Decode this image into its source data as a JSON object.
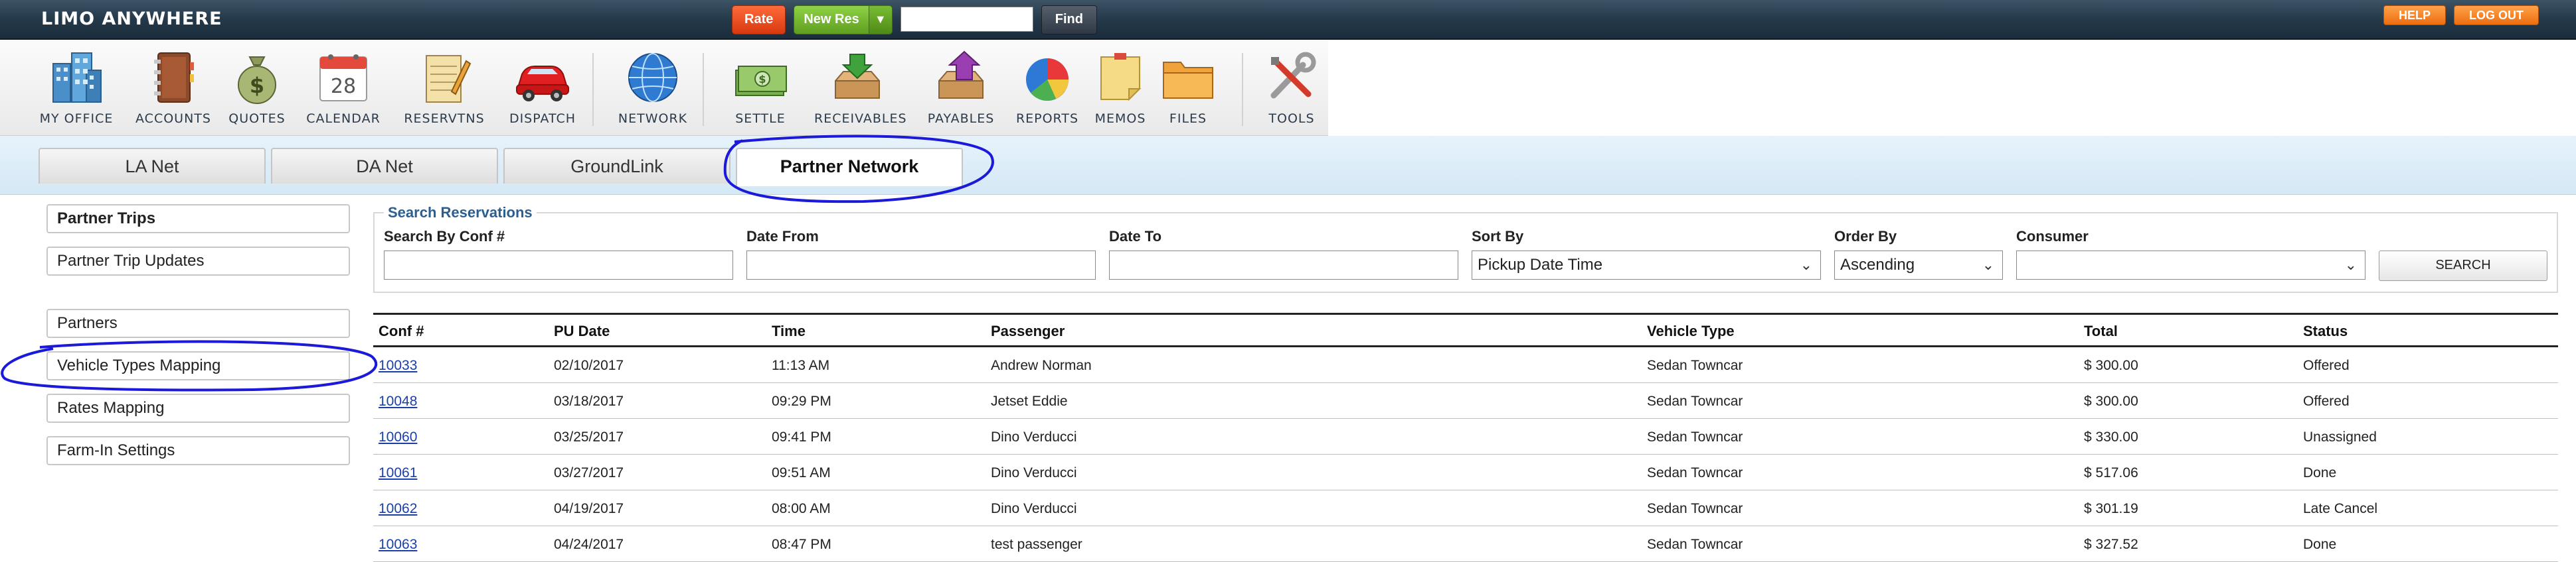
{
  "app": {
    "logo": "LIMO ANYWHERE"
  },
  "topbar": {
    "rate_label": "Rate",
    "new_res_label": "New Res",
    "search_value": "",
    "find_label": "Find",
    "help_label": "HELP",
    "logout_label": "LOG OUT"
  },
  "toolbar": {
    "items": [
      {
        "label": "MY OFFICE",
        "icon": "office-building-icon"
      },
      {
        "label": "ACCOUNTS",
        "icon": "address-book-icon"
      },
      {
        "label": "QUOTES",
        "icon": "money-bag-icon"
      },
      {
        "label": "CALENDAR",
        "icon": "calendar-icon",
        "day": "28"
      },
      {
        "label": "RESERVTNS",
        "icon": "notepad-icon"
      },
      {
        "label": "DISPATCH",
        "icon": "red-car-icon"
      },
      {
        "label": "NETWORK",
        "icon": "globe-icon"
      },
      {
        "label": "SETTLE",
        "icon": "cash-icon"
      },
      {
        "label": "RECEIVABLES",
        "icon": "inbox-arrow-icon"
      },
      {
        "label": "PAYABLES",
        "icon": "outbox-arrow-icon"
      },
      {
        "label": "REPORTS",
        "icon": "pie-chart-icon"
      },
      {
        "label": "MEMOS",
        "icon": "sticky-note-icon"
      },
      {
        "label": "FILES",
        "icon": "folder-icon"
      },
      {
        "label": "TOOLS",
        "icon": "tools-icon"
      }
    ]
  },
  "tabs": [
    {
      "label": "LA Net"
    },
    {
      "label": "DA Net"
    },
    {
      "label": "GroundLink"
    },
    {
      "label": "Partner Network"
    }
  ],
  "sidebar": {
    "items": [
      {
        "label": "Partner Trips"
      },
      {
        "label": "Partner Trip Updates"
      },
      {
        "label": "Partners"
      },
      {
        "label": "Vehicle Types Mapping"
      },
      {
        "label": "Rates Mapping"
      },
      {
        "label": "Farm-In Settings"
      }
    ]
  },
  "search": {
    "legend": "Search Reservations",
    "conf_label": "Search By Conf #",
    "conf_value": "",
    "date_from_label": "Date From",
    "date_from_value": "",
    "date_to_label": "Date To",
    "date_to_value": "",
    "sort_by_label": "Sort By",
    "sort_by_value": "Pickup Date Time",
    "order_by_label": "Order By",
    "order_by_value": "Ascending",
    "consumer_label": "Consumer",
    "consumer_value": "",
    "search_button": "SEARCH"
  },
  "table": {
    "headers": {
      "conf": "Conf #",
      "pu_date": "PU Date",
      "time": "Time",
      "passenger": "Passenger",
      "vehicle_type": "Vehicle Type",
      "total": "Total",
      "status": "Status"
    },
    "rows": [
      {
        "conf": "10033",
        "pu_date": "02/10/2017",
        "time": "11:13 AM",
        "passenger": "Andrew Norman",
        "vehicle_type": "Sedan Towncar",
        "total": "$ 300.00",
        "status": "Offered"
      },
      {
        "conf": "10048",
        "pu_date": "03/18/2017",
        "time": "09:29 PM",
        "passenger": "Jetset Eddie",
        "vehicle_type": "Sedan Towncar",
        "total": "$ 300.00",
        "status": "Offered"
      },
      {
        "conf": "10060",
        "pu_date": "03/25/2017",
        "time": "09:41 PM",
        "passenger": "Dino Verducci",
        "vehicle_type": "Sedan Towncar",
        "total": "$ 330.00",
        "status": "Unassigned"
      },
      {
        "conf": "10061",
        "pu_date": "03/27/2017",
        "time": "09:51 AM",
        "passenger": "Dino Verducci",
        "vehicle_type": "Sedan Towncar",
        "total": "$ 517.06",
        "status": "Done"
      },
      {
        "conf": "10062",
        "pu_date": "04/19/2017",
        "time": "08:00 AM",
        "passenger": "Dino Verducci",
        "vehicle_type": "Sedan Towncar",
        "total": "$ 301.19",
        "status": "Late Cancel"
      },
      {
        "conf": "10063",
        "pu_date": "04/24/2017",
        "time": "08:47 PM",
        "passenger": "test passenger",
        "vehicle_type": "Sedan Towncar",
        "total": "$ 327.52",
        "status": "Done"
      }
    ]
  },
  "colors": {
    "annotation": "#1a1ad8",
    "link": "#1a3fa8",
    "legend": "#2b5f91"
  }
}
